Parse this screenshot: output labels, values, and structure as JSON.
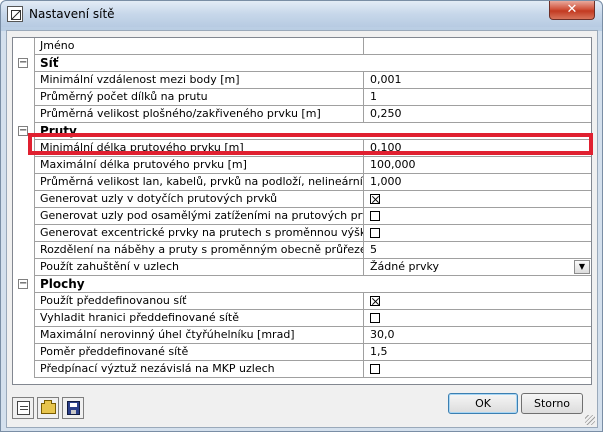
{
  "window": {
    "title": "Nastavení sítě",
    "close_glyph": "✕"
  },
  "grid": {
    "rows": [
      {
        "kind": "item",
        "name": "Jméno",
        "value": ""
      },
      {
        "kind": "category",
        "expander": "−",
        "name": "Síť"
      },
      {
        "kind": "item",
        "name": "Minimální vzdálenost mezi body [m]",
        "value": "0,001"
      },
      {
        "kind": "item",
        "name": "Průměrný počet dílků na prutu",
        "value": "1"
      },
      {
        "kind": "item",
        "name": "Průměrná velikost plošného/zakřiveného prvku [m]",
        "value": "0,250"
      },
      {
        "kind": "category",
        "expander": "−",
        "name": "Pruty"
      },
      {
        "kind": "item",
        "name": "Minimální délka prutového prvku [m]",
        "value": "0,100"
      },
      {
        "kind": "item",
        "name": "Maximální délka prutového prvku [m]",
        "value": "100,000"
      },
      {
        "kind": "item",
        "name": "Průměrná velikost lan, kabelů, prvků na podloží, nelineárních ze...",
        "value": "1,000"
      },
      {
        "kind": "item",
        "name": "Generovat uzly v dotyčích prutových prvků",
        "checkbox": true,
        "checked": true
      },
      {
        "kind": "item",
        "name": "Generovat uzly pod osamělými zatíženími na prutových prvcích",
        "checkbox": true,
        "checked": false
      },
      {
        "kind": "item",
        "name": "Generovat excentrické prvky na prutech s proměnnou výškou",
        "checkbox": true,
        "checked": false
      },
      {
        "kind": "item",
        "name": "Rozdělení na náběhy a pruty s proměnným obecně průřezem",
        "value": "5"
      },
      {
        "kind": "item",
        "name": "Použít zahuštění v uzlech",
        "value": "Žádné prvky",
        "dropdown": true
      },
      {
        "kind": "category",
        "expander": "−",
        "name": "Plochy"
      },
      {
        "kind": "item",
        "name": "Použít předdefinovanou síť",
        "checkbox": true,
        "checked": true
      },
      {
        "kind": "item",
        "name": "Vyhladit hranici předdefinované sítě",
        "checkbox": true,
        "checked": false
      },
      {
        "kind": "item",
        "name": "Maximální nerovinný úhel čtyřúhelníku [mrad]",
        "value": "30,0"
      },
      {
        "kind": "item",
        "name": "Poměr předdefinované sítě",
        "value": "1,5"
      },
      {
        "kind": "item",
        "name": "Předpínací výztuž nezávislá na MKP uzlech",
        "checkbox": true,
        "checked": false
      }
    ],
    "highlighted_row": 4,
    "highlight_color": "#e02030"
  },
  "toolbar": {
    "buttons": [
      {
        "icon": "new-document-icon"
      },
      {
        "icon": "open-folder-icon"
      },
      {
        "icon": "save-disk-icon"
      }
    ]
  },
  "buttons": {
    "ok_label": "OK",
    "cancel_label": "Storno"
  }
}
